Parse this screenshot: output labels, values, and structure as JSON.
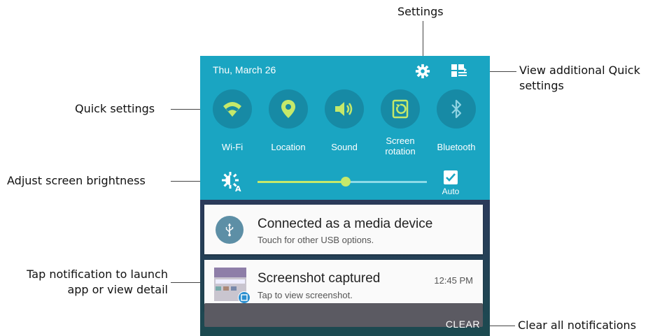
{
  "callouts": {
    "settings": "Settings",
    "view_additional": "View additional Quick settings",
    "quick_settings": "Quick settings",
    "adjust_brightness": "Adjust screen brightness",
    "tap_notification": "Tap notification to launch app or view detail",
    "clear_all": "Clear all notifications"
  },
  "panel": {
    "date": "Thu, March 26",
    "toggles": [
      {
        "label": "Wi-Fi",
        "icon": "wifi-icon",
        "active": true
      },
      {
        "label": "Location",
        "icon": "location-pin-icon",
        "active": true
      },
      {
        "label": "Sound",
        "icon": "speaker-icon",
        "active": true
      },
      {
        "label": "Screen rotation",
        "icon": "screen-rotation-icon",
        "active": true
      },
      {
        "label": "Bluetooth",
        "icon": "bluetooth-icon",
        "active": false
      }
    ],
    "brightness": {
      "auto_label": "Auto",
      "auto_checked": true,
      "level": 0.52
    }
  },
  "notifications": [
    {
      "title": "Connected as a media device",
      "subtitle": "Touch for other USB options.",
      "time": "",
      "icon": "usb-icon"
    },
    {
      "title": "Screenshot captured",
      "subtitle": "Tap to view screenshot.",
      "time": "12:45 PM",
      "icon": "screenshot-thumbnail"
    }
  ],
  "clear_label": "CLEAR",
  "colors": {
    "panel": "#1aa5c2",
    "button": "#178aa5",
    "accent": "#c5e96a"
  }
}
